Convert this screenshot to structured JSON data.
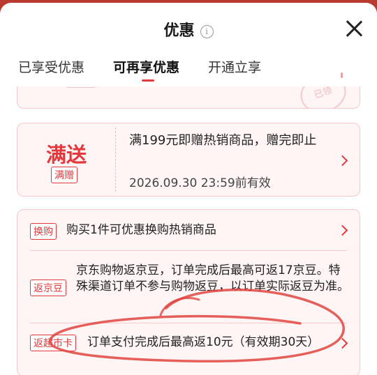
{
  "header": {
    "title": "优惠",
    "info_glyph": "i"
  },
  "tabs": [
    {
      "label": "已享受优惠",
      "active": false
    },
    {
      "label": "可再享优惠",
      "active": true
    },
    {
      "label": "开通立享",
      "active": false
    }
  ],
  "top_card": {
    "stamp": "已领"
  },
  "gift_card": {
    "big_label": "满送",
    "tag": "满赠",
    "description": "满199元即赠热销商品，赠完即止",
    "expiry": "2026.09.30 23:59前有效"
  },
  "promo_card": {
    "rows": [
      {
        "tag": "换购",
        "text": "购买1件可优惠换购热销商品"
      },
      {
        "tag": "返京豆",
        "text": "京东购物返京豆，订单完成后最高可返17京豆。特殊渠道订单不参与购物返豆，以订单实际返豆为准。"
      },
      {
        "tag": "返超市卡",
        "text": "订单支付完成后最高返10元（有效期30天）"
      }
    ]
  },
  "colors": {
    "accent": "#e4393c",
    "card_bg": "#fff5f5",
    "card_border": "#f6c9cc"
  }
}
